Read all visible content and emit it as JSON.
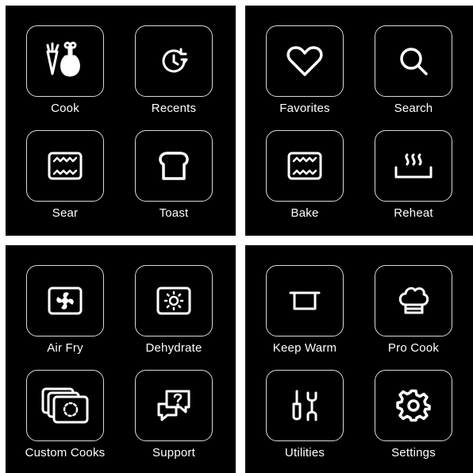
{
  "screens": [
    {
      "tiles": [
        {
          "label": "Cook",
          "icon": "carrot-drumstick-icon"
        },
        {
          "label": "Recents",
          "icon": "clock-history-icon"
        },
        {
          "label": "Sear",
          "icon": "sear-oven-icon"
        },
        {
          "label": "Toast",
          "icon": "bread-slice-icon"
        }
      ]
    },
    {
      "tiles": [
        {
          "label": "Favorites",
          "icon": "heart-icon"
        },
        {
          "label": "Search",
          "icon": "search-icon"
        },
        {
          "label": "Bake",
          "icon": "bake-oven-icon"
        },
        {
          "label": "Reheat",
          "icon": "reheat-steam-icon"
        }
      ]
    },
    {
      "tiles": [
        {
          "label": "Air Fry",
          "icon": "air-fry-fan-icon"
        },
        {
          "label": "Dehydrate",
          "icon": "dehydrate-sun-icon"
        },
        {
          "label": "Custom Cooks",
          "icon": "stacked-cards-icon"
        },
        {
          "label": "Support",
          "icon": "support-chat-icon"
        }
      ]
    },
    {
      "tiles": [
        {
          "label": "Keep Warm",
          "icon": "pot-icon"
        },
        {
          "label": "Pro Cook",
          "icon": "chef-hat-icon"
        },
        {
          "label": "Utilities",
          "icon": "tools-icon"
        },
        {
          "label": "Settings",
          "icon": "gear-icon"
        }
      ]
    }
  ],
  "colors": {
    "background": "#000000",
    "text": "#ffffff",
    "tile_border": "#d8d8d8",
    "gap": "#ffffff"
  }
}
